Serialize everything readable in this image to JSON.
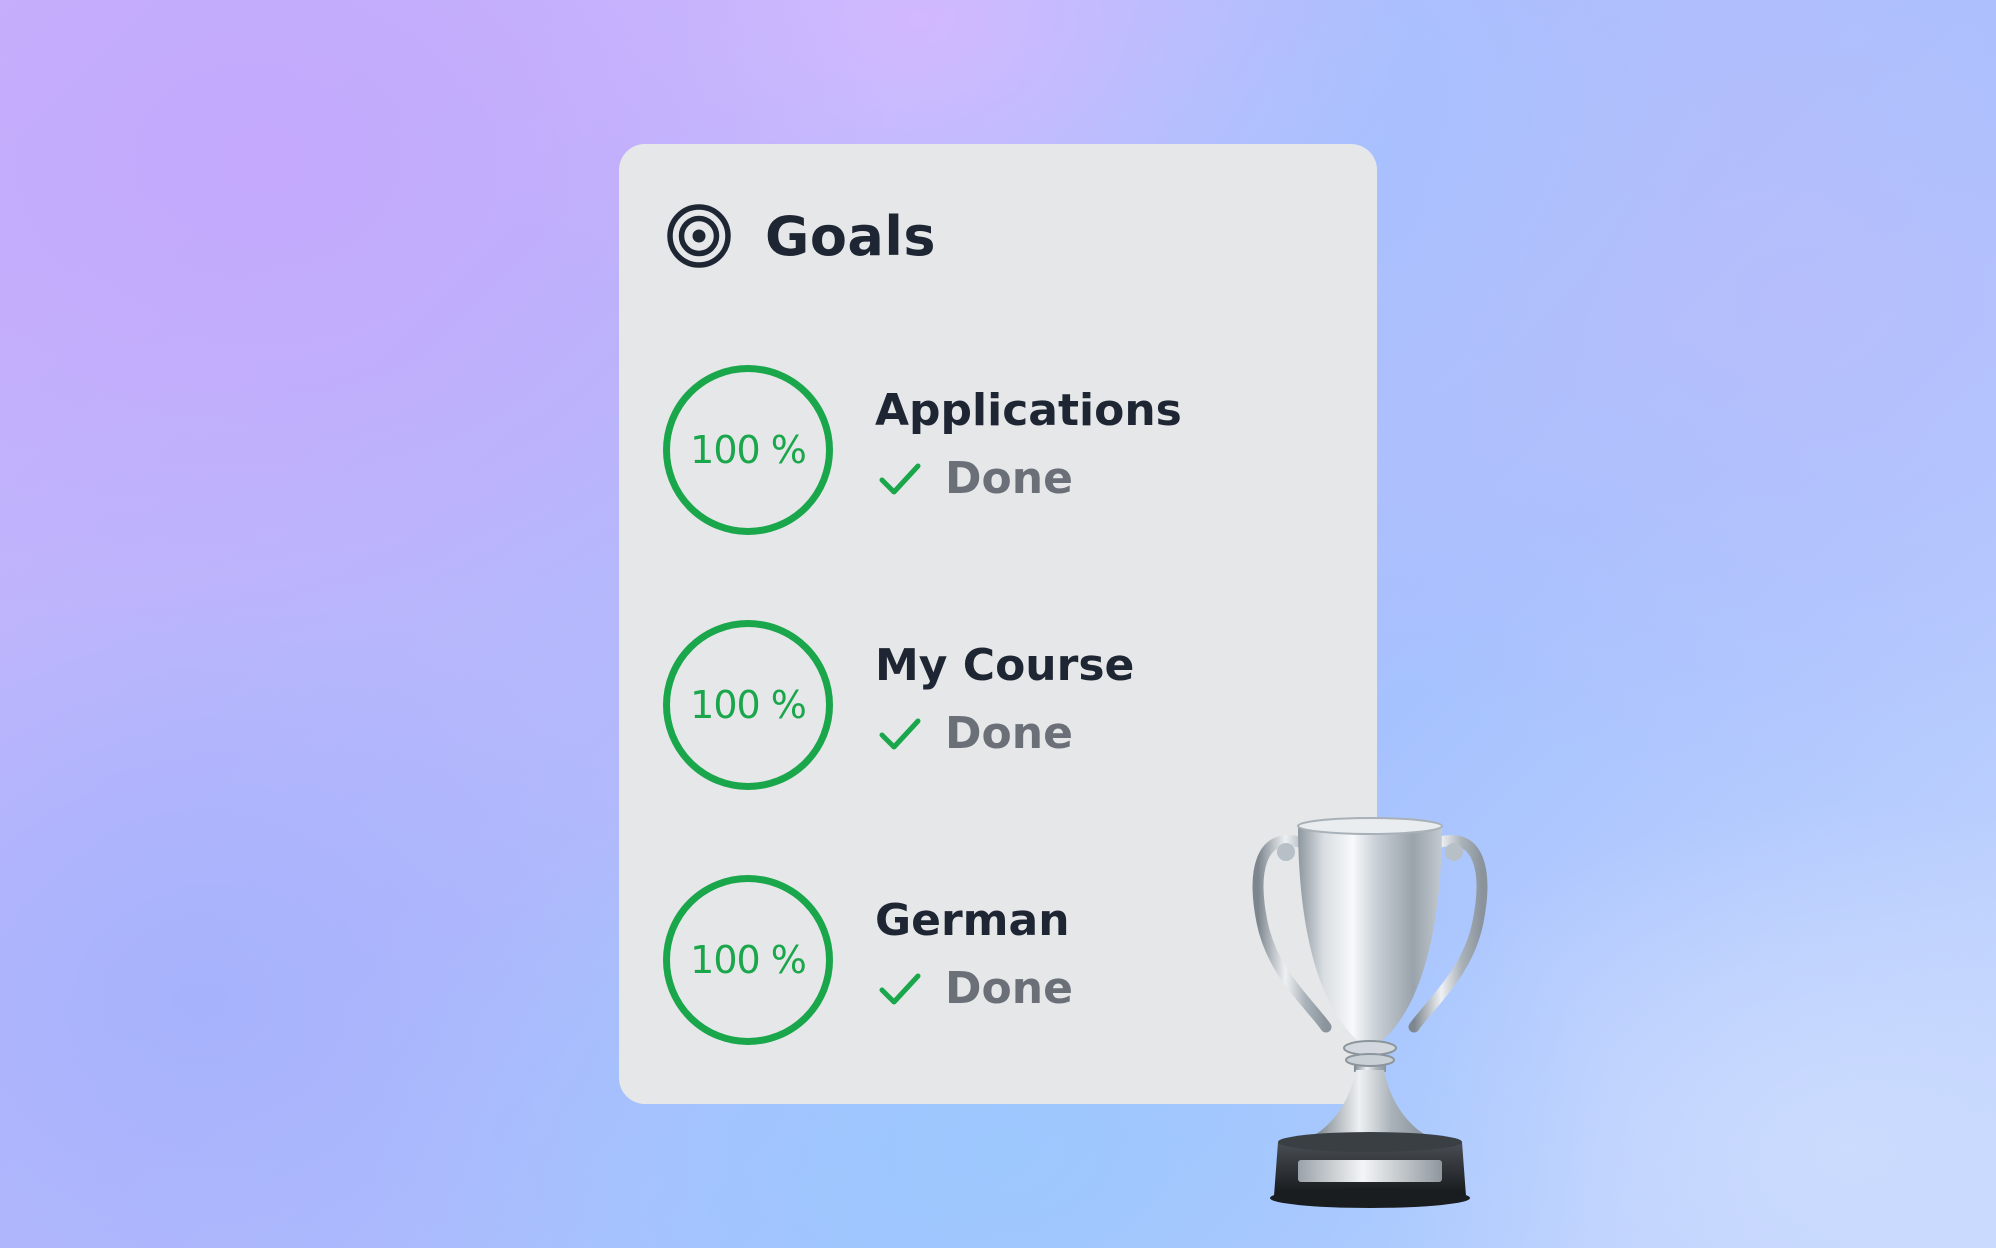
{
  "card": {
    "title": "Goals",
    "header_icon": "target-icon"
  },
  "goals": [
    {
      "name": "Applications",
      "percent_label": "100 %",
      "progress": 1.0,
      "status": "Done",
      "status_icon": "checkmark-icon"
    },
    {
      "name": "My Course",
      "percent_label": "100 %",
      "progress": 1.0,
      "status": "Done",
      "status_icon": "checkmark-icon"
    },
    {
      "name": "German",
      "percent_label": "100 %",
      "progress": 1.0,
      "status": "Done",
      "status_icon": "checkmark-icon"
    }
  ],
  "decoration": {
    "icon": "trophy-icon"
  },
  "colors": {
    "progress_green": "#1aa64a",
    "card_background": "#e5e7e8",
    "title_text": "#1f2633",
    "status_text": "#6b7078"
  }
}
